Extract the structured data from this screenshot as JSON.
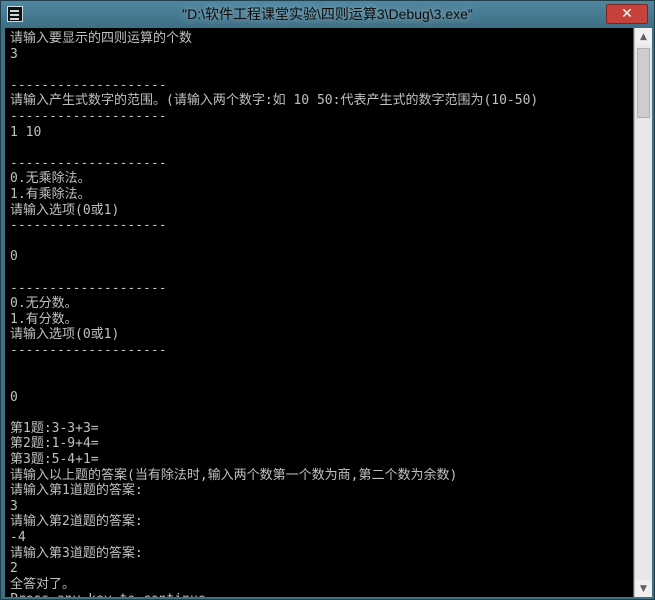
{
  "window": {
    "title": "\"D:\\软件工程课堂实验\\四则运算3\\Debug\\3.exe\"",
    "close_glyph": "✕",
    "icon": "console-app-icon"
  },
  "colors": {
    "console_bg": "#000000",
    "console_text": "#c0c0c0",
    "close_button": "#c7423a",
    "titlebar": "#3e6f85"
  },
  "console": {
    "lines": [
      "请输入要显示的四则运算的个数",
      "3",
      "",
      "--------------------",
      "请输入产生式数字的范围。(请输入两个数字:如 10 50:代表产生式的数字范围为(10-50)",
      "--------------------",
      "1 10",
      "",
      "--------------------",
      "0.无乘除法。",
      "1.有乘除法。",
      "请输入选项(0或1)",
      "--------------------",
      "",
      "0",
      "",
      "--------------------",
      "0.无分数。",
      "1.有分数。",
      "请输入选项(0或1)",
      "--------------------",
      "",
      "",
      "0",
      "",
      "第1题:3-3+3=",
      "第2题:1-9+4=",
      "第3题:5-4+1=",
      "请输入以上题的答案(当有除法时,输入两个数第一个数为商,第二个数为余数)",
      "请输入第1道题的答案:",
      "3",
      "请输入第2道题的答案:",
      "-4",
      "请输入第3道题的答案:",
      "2",
      "全答对了。",
      "Press any key to continue"
    ]
  }
}
